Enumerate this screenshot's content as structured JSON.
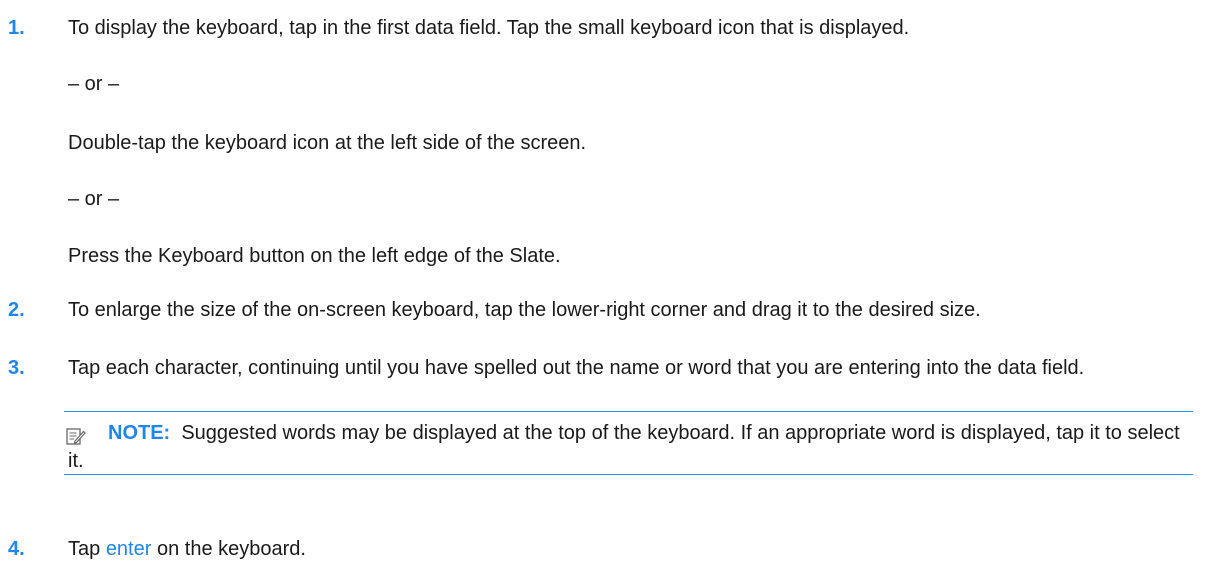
{
  "steps": [
    {
      "number": "1.",
      "text": "To display the keyboard, tap in the first data field. Tap the small keyboard icon that is displayed.",
      "alternatives": [
        {
          "separator": "– or –",
          "text": "Double-tap the keyboard icon at the left side of the screen."
        },
        {
          "separator": "– or –",
          "text": "Press the Keyboard button on the left edge of the Slate."
        }
      ]
    },
    {
      "number": "2.",
      "text": "To enlarge the size of the on-screen keyboard, tap the lower-right corner and drag it to the desired size."
    },
    {
      "number": "3.",
      "text": "Tap each character, continuing until you have spelled out the name or word that you are entering into the data field."
    },
    {
      "number": "4.",
      "text_before": "Tap",
      "link": "enter",
      "text_after": "on the keyboard."
    }
  ],
  "note": {
    "icon": "note-icon",
    "label": "NOTE:",
    "text": "Suggested words may be displayed at the top of the keyboard. If an appropriate word is displayed, tap it to select it."
  },
  "colors": {
    "accent": "#1f86f0",
    "text": "#1a1a1a",
    "rule": "#2b8ff0"
  }
}
